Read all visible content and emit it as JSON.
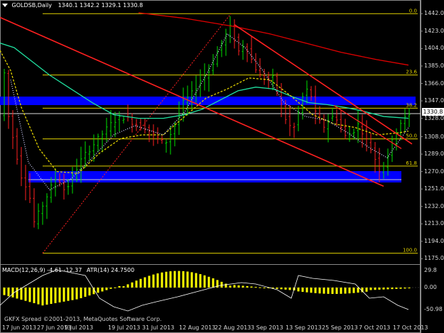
{
  "header": {
    "symbol": "GOLDSB,Daily",
    "ohlc": "1340.1 1342.2 1329.1 1330.8"
  },
  "price_axis": {
    "labels": [
      "1442.0",
      "1423.0",
      "1404.0",
      "1385.0",
      "1366.0",
      "1347.0",
      "1328.0",
      "1308.0",
      "1289.0",
      "1270.0",
      "1251.0",
      "1232.0",
      "1213.0",
      "1194.0",
      "1175.0"
    ],
    "current": "1330.8"
  },
  "fib_levels": [
    {
      "label": "0.0",
      "price": 1442.0
    },
    {
      "label": "23.6",
      "price": 1375.2
    },
    {
      "label": "38.2",
      "price": 1339.0
    },
    {
      "label": "50.0",
      "price": 1305.6
    },
    {
      "label": "61.8",
      "price": 1276.0
    },
    {
      "label": "100.0",
      "price": 1181.0
    }
  ],
  "macd": {
    "header": "MACD(12,26,9) -4.61 -12.37",
    "atr": "ATR(14) 24.7500",
    "axis": [
      "29.8",
      "0.00",
      "-50.98"
    ]
  },
  "time_axis": [
    "17 Jun 2013",
    "27 Jun 2013",
    "9 Jul 2013",
    "19 Jul 2013",
    "31 Jul 2013",
    "12 Aug 2013",
    "22 Aug 2013",
    "3 Sep 2013",
    "13 Sep 2013",
    "25 Sep 2013",
    "7 Oct 2013",
    "17 Oct 2013"
  ],
  "copyright": "GKFX Spread ©2001-2013, MetaQuotes Software Corp.",
  "colors": {
    "bull": "#00e000",
    "bear": "#ff2020",
    "ma_slow": "#e00000",
    "ma_mid": "#20e0a0",
    "ma_fast": "#e0d000",
    "zone": "#0000ff",
    "fib": "#e0d000",
    "macd_hist": "#ffff00"
  }
}
